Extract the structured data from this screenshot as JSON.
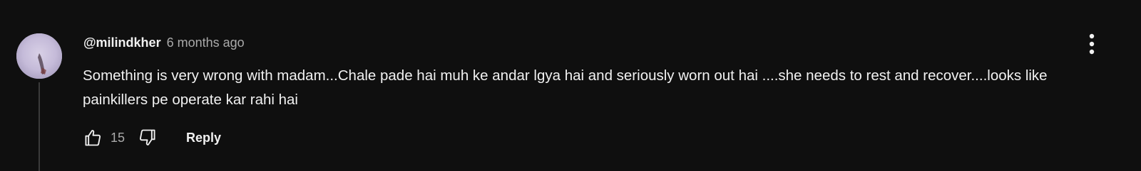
{
  "comment": {
    "author": "@milindkher",
    "timestamp": "6 months ago",
    "text": "Something is very wrong with madam...Chale pade hai muh ke andar lgya hai and seriously worn out hai ....she needs to rest and recover....looks like painkillers pe operate kar rahi hai",
    "like_count": "15",
    "reply_label": "Reply"
  },
  "icons": {
    "like": "thumbs-up-icon",
    "dislike": "thumbs-down-icon",
    "menu": "more-vert-icon"
  },
  "colors": {
    "background": "#0f0f0f",
    "text_primary": "#f1f1f1",
    "text_secondary": "#aaaaaa",
    "thread_line": "#3a3a3a"
  }
}
